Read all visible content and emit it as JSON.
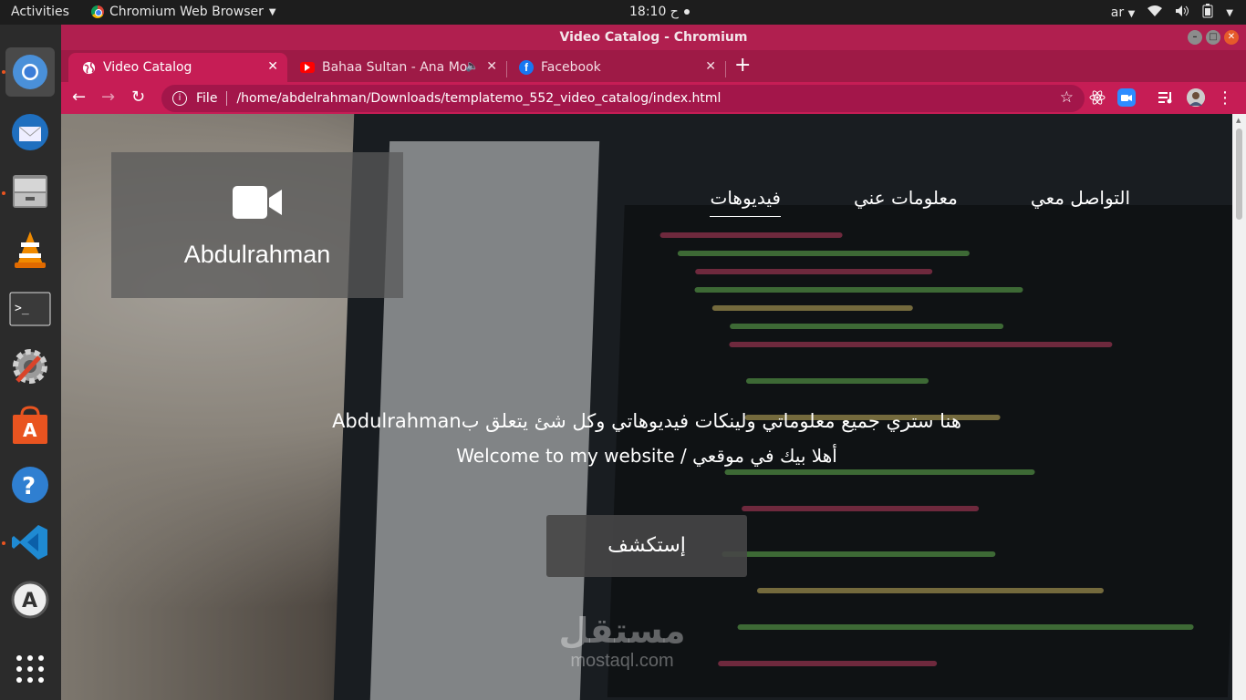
{
  "system_bar": {
    "activities": "Activities",
    "app_name": "Chromium Web Browser",
    "clock": "ح 18:10",
    "language": "ar"
  },
  "window": {
    "title": "Video Catalog - Chromium"
  },
  "tabs": [
    {
      "label": "Video Catalog",
      "active": true
    },
    {
      "label": "Bahaa Sultan - Ana Mo",
      "active": false
    },
    {
      "label": "Facebook",
      "active": false
    }
  ],
  "address_bar": {
    "scheme": "File",
    "url": "/home/abdelrahman/Downloads/templatemo_552_video_catalog/index.html"
  },
  "site": {
    "brand_name": "Abdulrahman",
    "nav": [
      {
        "label": "التواصل معي"
      },
      {
        "label": "معلومات عني"
      },
      {
        "label": "فيديوهات",
        "current": true
      }
    ],
    "hero_line1": "هنا ستري جميع معلوماتي ولينكات فيديوهاتي وكل شئ يتعلق بAbdulrahman",
    "hero_line2": "أهلا بيك في موقعي / Welcome to my website",
    "explore_button": "إستكشف"
  },
  "watermark": {
    "arabic": "مستقل",
    "latin": "mostaql.com"
  },
  "colors": {
    "chrome_theme": "#c61d55",
    "tabbar": "#9e1a46",
    "dock": "#2b2b2b"
  }
}
